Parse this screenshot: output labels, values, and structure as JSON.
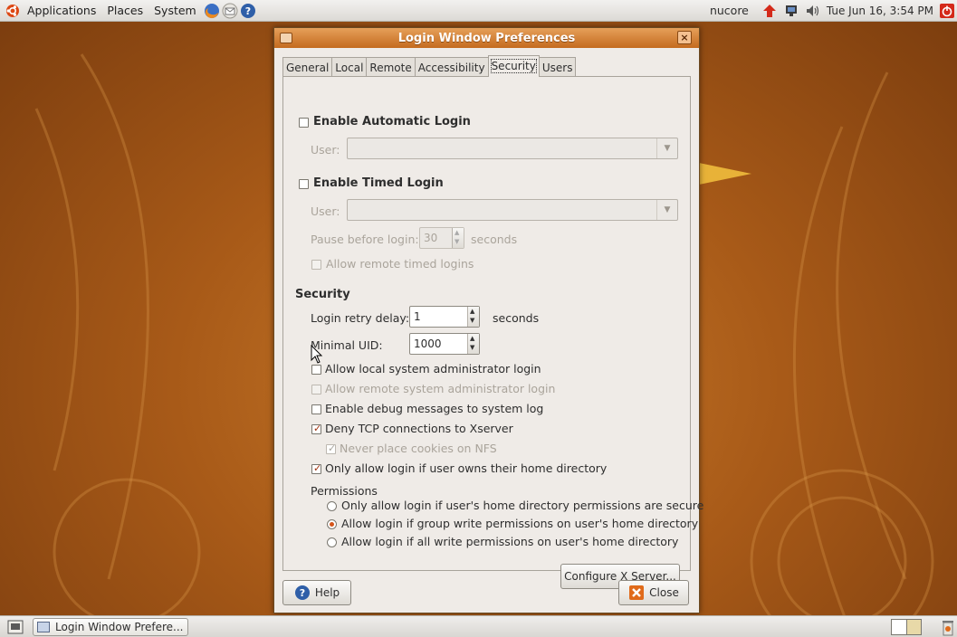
{
  "top_panel": {
    "menus": [
      "Applications",
      "Places",
      "System"
    ],
    "launchers": [
      "firefox-icon",
      "mail-icon",
      "help-icon"
    ],
    "user": "nucore",
    "clock": "Tue Jun 16,  3:54 PM"
  },
  "dialog": {
    "title": "Login Window Preferences",
    "tabs": [
      "General",
      "Local",
      "Remote",
      "Accessibility",
      "Security",
      "Users"
    ],
    "active_tab": "Security",
    "auto_login": {
      "label": "Enable Automatic Login",
      "checked": false,
      "user_label": "User:",
      "user_value": ""
    },
    "timed_login": {
      "label": "Enable Timed Login",
      "checked": false,
      "user_label": "User:",
      "user_value": "",
      "pause_label": "Pause before login:",
      "pause_value": "30",
      "pause_unit": "seconds",
      "allow_remote": "Allow remote timed logins"
    },
    "security": {
      "heading": "Security",
      "retry_label": "Login retry delay:",
      "retry_value": "1",
      "retry_unit": "seconds",
      "uid_label": "Minimal UID:",
      "uid_value": "1000",
      "options": [
        {
          "label": "Allow local system administrator login",
          "checked": false
        },
        {
          "label": "Allow remote system administrator login",
          "checked": false
        },
        {
          "label": "Enable debug messages to system log",
          "checked": false
        },
        {
          "label": "Deny TCP connections to Xserver",
          "checked": true
        },
        {
          "label": "Never place cookies on NFS",
          "checked": true
        },
        {
          "label": "Only allow login if user owns their home directory",
          "checked": true
        }
      ]
    },
    "permissions": {
      "heading": "Permissions",
      "options": [
        "Only allow login if user's home directory permissions are secure",
        "Allow login if group write permissions on user's home directory",
        "Allow login if all write permissions on user's home directory"
      ],
      "selected": "Allow login if group write permissions on user's home directory"
    },
    "configure_button": "Configure X Server...",
    "help_button": "Help",
    "close_button": "Close"
  },
  "bottom_panel": {
    "task": "Login Window Prefere..."
  },
  "colors": {
    "accent": "#d4541a",
    "titlebar": "#c46a1e",
    "desktop": "#a85a18"
  }
}
